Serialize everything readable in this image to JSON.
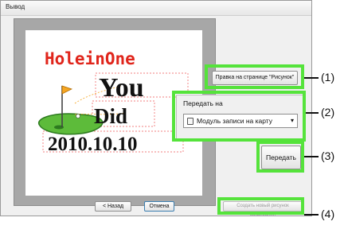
{
  "window": {
    "title": "Вывод"
  },
  "design": {
    "line1": "HoleinOne",
    "line2": "You",
    "line3": "Did",
    "line4": "2010.10.10"
  },
  "edit_button": {
    "label": "Правка на странице \"Рисунок\""
  },
  "transfer_group": {
    "label": "Передать на",
    "selected": "Модуль записи на карту"
  },
  "transfer_button": {
    "label": "Передать"
  },
  "create_new_button": {
    "label": "Создать новый рисунок вышивания"
  },
  "nav": {
    "back_label": "< Назад",
    "cancel_label": "Отмена"
  },
  "callouts": [
    "(1)",
    "(2)",
    "(3)",
    "(4)"
  ],
  "colors": {
    "highlight": "#55e33b",
    "title_red": "#e0251b",
    "grass": "#5dbb3a",
    "flag": "#f5a623"
  },
  "icons": [
    "card-writer-icon",
    "dropdown-arrow-icon",
    "golf-flag-icon"
  ]
}
